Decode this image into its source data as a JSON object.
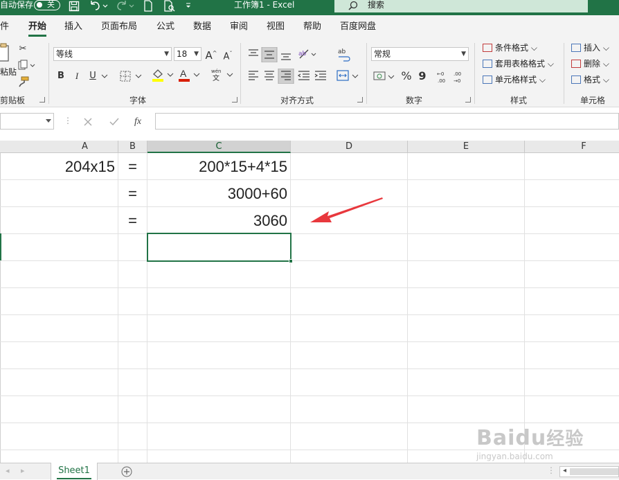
{
  "titlebar": {
    "autosave_label": "自动保存",
    "autosave_state": "关",
    "doc_title": "工作簿1  -  Excel",
    "search_label": "搜索"
  },
  "tabs": [
    {
      "label": "件",
      "active": false
    },
    {
      "label": "开始",
      "active": true
    },
    {
      "label": "插入",
      "active": false
    },
    {
      "label": "页面布局",
      "active": false
    },
    {
      "label": "公式",
      "active": false
    },
    {
      "label": "数据",
      "active": false
    },
    {
      "label": "审阅",
      "active": false
    },
    {
      "label": "视图",
      "active": false
    },
    {
      "label": "帮助",
      "active": false
    },
    {
      "label": "百度网盘",
      "active": false
    }
  ],
  "ribbon": {
    "clipboard": {
      "label": "剪贴板",
      "paste_label": "粘贴"
    },
    "font": {
      "label": "字体",
      "font_name": "等线",
      "font_size": "18",
      "grow": "A",
      "shrink": "A",
      "bold": "B",
      "italic": "I",
      "underline": "U",
      "font_color": "#d81e06",
      "highlight_color": "#ffff00"
    },
    "alignment": {
      "label": "对齐方式"
    },
    "number": {
      "label": "数字",
      "format": "常规",
      "percent": "%",
      "comma": "9"
    },
    "styles": {
      "label": "样式",
      "items": [
        "条件格式",
        "套用表格格式",
        "单元格样式"
      ]
    },
    "cells": {
      "label": "单元格",
      "items": [
        "插入",
        "删除",
        "格式"
      ]
    }
  },
  "formula_bar": {
    "fx": "fx",
    "value": ""
  },
  "columns": [
    {
      "name": "A",
      "selected": false
    },
    {
      "name": "B",
      "selected": false
    },
    {
      "name": "C",
      "selected": true
    },
    {
      "name": "D",
      "selected": false
    },
    {
      "name": "E",
      "selected": false
    },
    {
      "name": "F",
      "selected": false
    }
  ],
  "cells": {
    "a1": "204x15",
    "b1": "=",
    "c1": "200*15+4*15",
    "b2": "=",
    "c2": "3000+60",
    "b3": "=",
    "c3": "3060"
  },
  "annotation": {
    "arrow_color": "#e8383d"
  },
  "sheets": [
    {
      "name": "Sheet1",
      "active": true
    }
  ],
  "colors": {
    "excel_green": "#217346"
  },
  "watermark": {
    "brand": "Baidu",
    "brand_cn": "经验",
    "url": "jingyan.baidu.com"
  }
}
